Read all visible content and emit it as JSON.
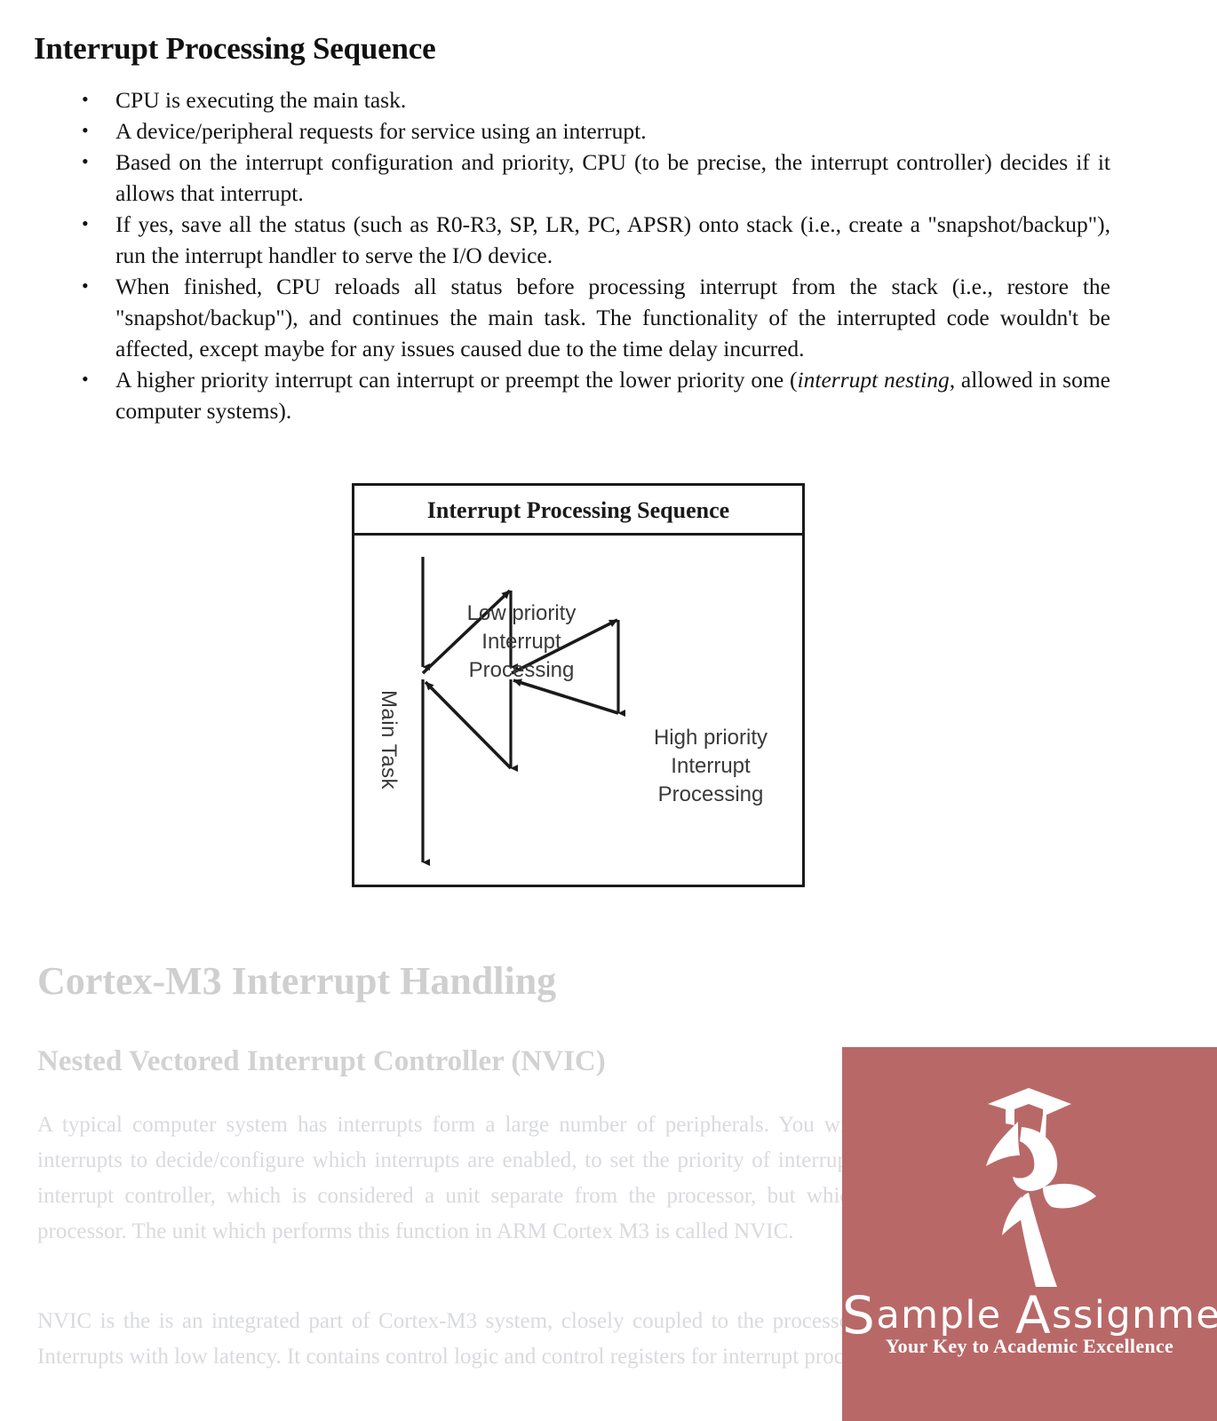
{
  "document": {
    "title": "Interrupt Processing Sequence",
    "bullets": [
      "CPU is executing the main task.",
      "A device/peripheral requests for service using an interrupt.",
      "Based on the interrupt configuration and priority, CPU (to be precise, the interrupt controller) decides if it allows that interrupt.",
      "If yes, save all the status (such as R0-R3, SP, LR, PC, APSR) onto stack (i.e., create a \"snapshot/backup\"), run the interrupt handler to serve the I/O device.",
      "When finished, CPU reloads all status before processing interrupt from the stack (i.e., restore the \"snapshot/backup\"), and continues the main task. The functionality of the interrupted code wouldn't be affected, except maybe for any issues caused due to the time delay incurred."
    ],
    "bullet_last_prefix": "A higher priority interrupt can interrupt or preempt the lower priority one (",
    "bullet_last_italic_1": "interrupt nesting,",
    "bullet_last_suffix": " allowed in some computer systems)."
  },
  "figure": {
    "caption": "Interrupt Processing Sequence",
    "label_main_task": "Main Task",
    "label_low_line1": "Low priority",
    "label_low_line2": "Interrupt",
    "label_low_line3": "Processing",
    "label_high_line1": "High priority",
    "label_high_line2": "Interrupt",
    "label_high_line3": "Processing",
    "line_color": "#1a1a1a",
    "text_color": "#3a3a3a"
  },
  "sections": {
    "heading_1": "Cortex-M3 Interrupt Handling",
    "heading_2": "Nested Vectored Interrupt Controller (NVIC)",
    "paragraph_1": "A typical computer system has interrupts form a large number of peripherals. You will need a \"manager\" for the interrupts to decide/configure which interrupts are enabled, to set the priority of interrupts etc. This is done using an interrupt controller, which is considered a unit separate from the processor, but which is closely coupled to the processor. The unit which performs this function in ARM Cortex M3 is called NVIC.",
    "paragraph_2": "NVIC is the is an integrated part of Cortex-M3 system, closely coupled to the processor. It handles Exceptions and Interrupts with low latency. It contains control logic and control registers for interrupt processing.",
    "faded_color": "#d9dade",
    "heading_faded_color": "#cfcfcf"
  },
  "watermark": {
    "brand_cap": "S",
    "brand_rest_1": "ample ",
    "brand_cap_2": "A",
    "brand_rest_2": "ssignment",
    "brand_full": "Sample Assignment",
    "tagline": "Your Key to Academic Excellence",
    "background_color": "#b96868",
    "foreground_color": "#ffffff"
  }
}
